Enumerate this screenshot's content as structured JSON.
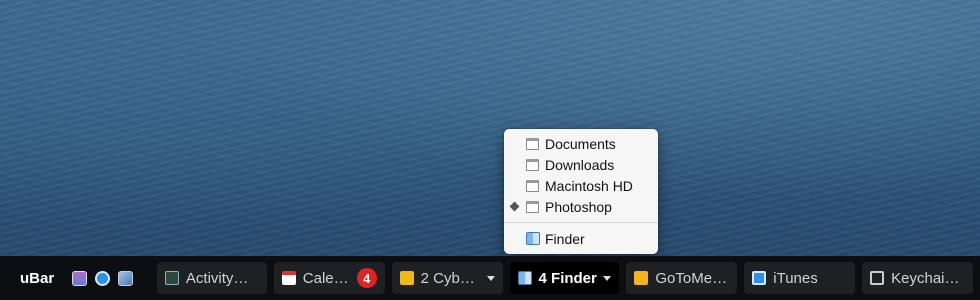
{
  "taskbar": {
    "brand": "uBar",
    "tray_icons": [
      "photo-browser-icon",
      "itunes-icon",
      "preview-icon"
    ],
    "tasks": [
      {
        "label": "Activity…",
        "icon": "activity-monitor-icon"
      },
      {
        "label": "Cale…",
        "icon": "calendar-icon",
        "badge": "4"
      },
      {
        "label": "2 Cyb…",
        "icon": "cyberduck-icon",
        "has_menu": true
      },
      {
        "label": "4 Finder",
        "icon": "finder-icon",
        "has_menu": true,
        "active": true
      },
      {
        "label": "GoToMe…",
        "icon": "gotomeeting-icon"
      },
      {
        "label": "iTunes",
        "icon": "itunes-icon"
      },
      {
        "label": "Keychai…",
        "icon": "keychain-icon"
      }
    ]
  },
  "finder_menu": {
    "windows": [
      "Documents",
      "Downloads",
      "Macintosh HD",
      "Photoshop"
    ],
    "current_window": "Photoshop",
    "app_item": "Finder"
  },
  "colors": {
    "taskbar_bg": "#0c0e11",
    "task_bg": "#1e2124",
    "badge": "#e02420",
    "desktop": "#2f577c"
  }
}
